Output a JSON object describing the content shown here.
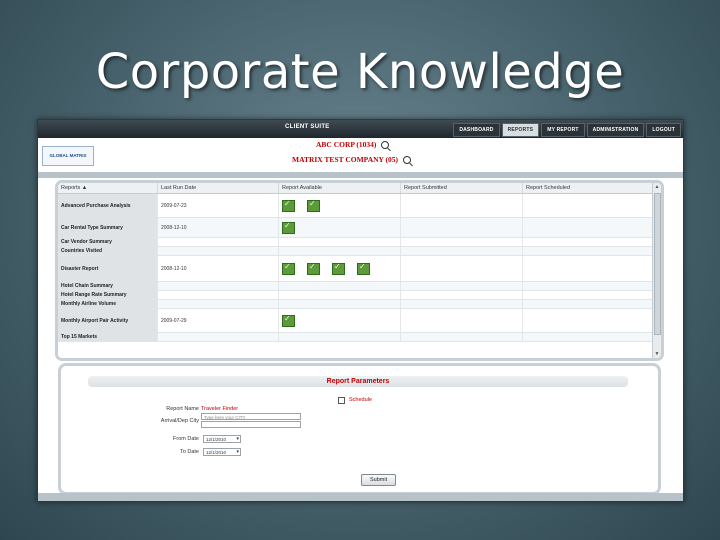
{
  "slide": {
    "title": "Corporate Knowledge"
  },
  "app": {
    "suite_label": "CLIENT SUITE",
    "nav": [
      "DASHBOARD",
      "REPORTS",
      "MY REPORT",
      "ADMINISTRATION",
      "LOGOUT"
    ],
    "active_nav": "REPORTS",
    "logo_text": "GLOBAL MATRIX",
    "company_primary": "ABC CORP (1034)",
    "company_secondary": "MATRIX TEST COMPANY (05)"
  },
  "grid": {
    "columns": [
      "Reports ▲",
      "Last Run Date",
      "Report Available",
      "Report Submitted",
      "Report Scheduled"
    ],
    "rows": [
      {
        "name": "Advanced Purchase Analysis",
        "last_run": "2009-07-23",
        "files": 2
      },
      {
        "name": "Car Rental Type Summary",
        "last_run": "2008-12-10",
        "files": 1
      },
      {
        "name": "Car Vendor Summary",
        "last_run": "",
        "files": 0
      },
      {
        "name": "Countries Visited",
        "last_run": "",
        "files": 0
      },
      {
        "name": "Disaster Report",
        "last_run": "2008-12-10",
        "files": 4
      },
      {
        "name": "Hotel Chain Summary",
        "last_run": "",
        "files": 0
      },
      {
        "name": "Hotel Range Rate Summary",
        "last_run": "",
        "files": 0
      },
      {
        "name": "Monthly Airline Volume",
        "last_run": "",
        "files": 0
      },
      {
        "name": "Monthly Airport Pair Activity",
        "last_run": "2009-07-29",
        "files": 1
      },
      {
        "name": "Top 15 Markets",
        "last_run": "",
        "files": 0
      }
    ]
  },
  "params": {
    "title": "Report Parameters",
    "schedule_label": "Schedule",
    "report_name_label": "Report Name",
    "report_name_value": "Traveler Finder",
    "arrival_label": "Arrival/Dep City",
    "arrival_placeholder": "Type here your CITY",
    "from_label": "From Date",
    "from_value": "12/1/2010",
    "to_label": "To Date",
    "to_value": "12/1/2010",
    "submit_label": "Submit"
  }
}
